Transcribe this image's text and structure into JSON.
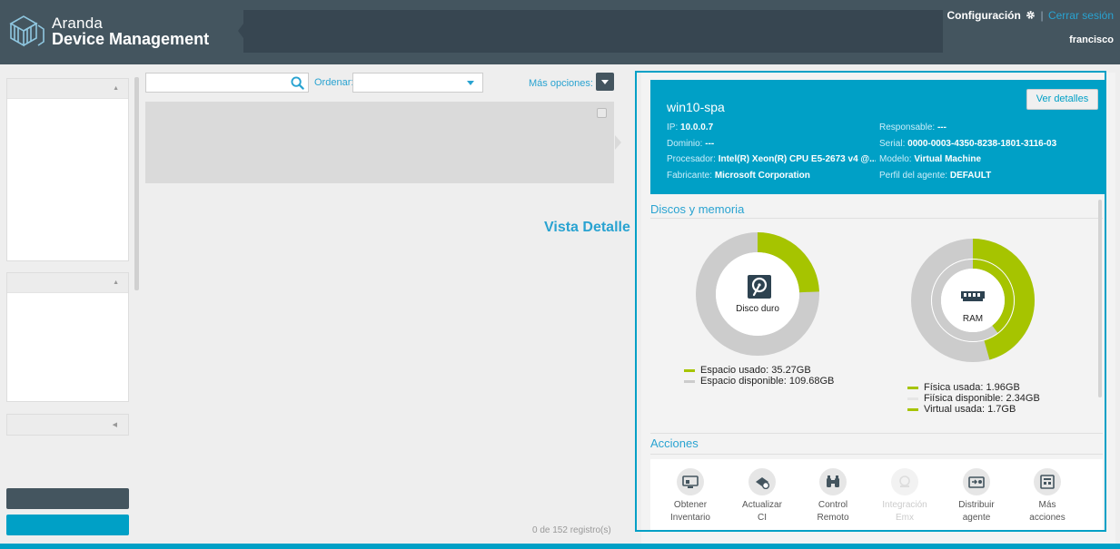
{
  "header": {
    "brand_line1": "Aranda",
    "brand_line2": "Device Management",
    "config_label": "Configuración",
    "separator": "|",
    "logout_label": "Cerrar sesión",
    "username": "francisco"
  },
  "toolbar": {
    "order_label": "Ordenar:",
    "more_options_label": "Más opciones:"
  },
  "list": {
    "records": "0 de 152 registro(s)",
    "view_label": "Vista Detalle"
  },
  "device": {
    "name": "win10-spa",
    "details_button": "Ver detalles",
    "fields": {
      "ip": {
        "k": "IP:",
        "v": "10.0.0.7"
      },
      "domain": {
        "k": "Dominio:",
        "v": "---"
      },
      "processor": {
        "k": "Procesador:",
        "v": "Intel(R) Xeon(R) CPU E5-2673 v4 @..."
      },
      "manufacturer": {
        "k": "Fabricante:",
        "v": "Microsoft Corporation"
      },
      "owner": {
        "k": "Responsable:",
        "v": "---"
      },
      "serial": {
        "k": "Serial:",
        "v": "0000-0003-4350-8238-1801-3116-03"
      },
      "model": {
        "k": "Modelo:",
        "v": "Virtual Machine"
      },
      "agent_profile": {
        "k": "Perfil del agente:",
        "v": "DEFAULT"
      }
    }
  },
  "disks": {
    "section_title": "Discos y memoria",
    "hdd": {
      "label": "Disco duro",
      "used_label": "Espacio usado: 35.27GB",
      "free_label": "Espacio disponible: 109.68GB",
      "used_gb": 35.27,
      "free_gb": 109.68
    },
    "ram": {
      "label": "RAM",
      "physical_used_label": "Física usada: 1.96GB",
      "physical_free_label": "Fiísica disponible: 2.34GB",
      "virtual_used_label": "Virtual usada: 1.7GB",
      "physical_used_gb": 1.96,
      "physical_free_gb": 2.34,
      "virtual_used_gb": 1.7
    },
    "colors": {
      "used": "#a6c400",
      "free": "#cccccc",
      "free_light": "#e6e6e6"
    }
  },
  "actions": {
    "section_title": "Acciones",
    "items": [
      {
        "line1": "Obtener",
        "line2": "Inventario",
        "icon": "inventory-icon",
        "disabled": false
      },
      {
        "line1": "Actualizar",
        "line2": "CI",
        "icon": "update-ci-icon",
        "disabled": false
      },
      {
        "line1": "Control",
        "line2": "Remoto",
        "icon": "binoculars-icon",
        "disabled": false
      },
      {
        "line1": "Integración",
        "line2": "Emx",
        "icon": "integration-icon",
        "disabled": true
      },
      {
        "line1": "Distribuir",
        "line2": "agente",
        "icon": "distribute-icon",
        "disabled": false
      },
      {
        "line1": "Más",
        "line2": "acciones",
        "icon": "more-actions-icon",
        "disabled": false
      }
    ]
  }
}
